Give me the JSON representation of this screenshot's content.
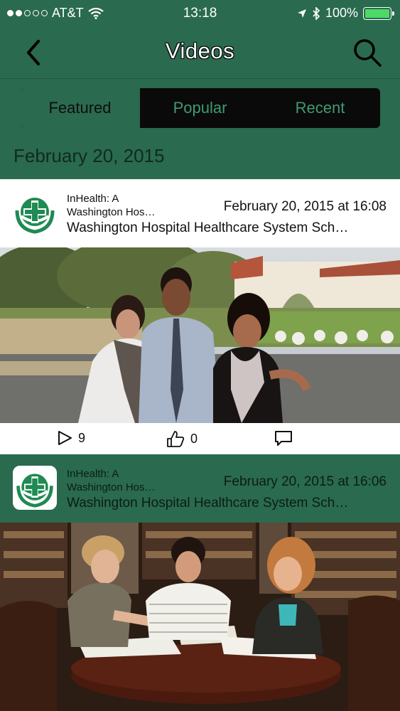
{
  "status": {
    "carrier": "AT&T",
    "time": "13:18",
    "battery": "100%",
    "battery_level": 1.0
  },
  "nav": {
    "title": "Videos"
  },
  "tabs": [
    {
      "label": "Featured",
      "active": true
    },
    {
      "label": "Popular",
      "active": false
    },
    {
      "label": "Recent",
      "active": false
    }
  ],
  "section_date": "February 20, 2015",
  "videos": [
    {
      "channel_line1": "InHealth: A",
      "channel_line2": "Washington Hos…",
      "date": "February 20, 2015 at 16:08",
      "title": "Washington Hospital Healthcare System Sch…",
      "plays": "9",
      "likes": "0"
    },
    {
      "channel_line1": "InHealth: A",
      "channel_line2": "Washington Hos…",
      "date": "February 20, 2015 at 16:06",
      "title": "Washington Hospital Healthcare System Sch…"
    }
  ],
  "colors": {
    "brand_green": "#2a6a4f",
    "segment_bg": "#0a0a0a",
    "battery_green": "#4cd964"
  }
}
